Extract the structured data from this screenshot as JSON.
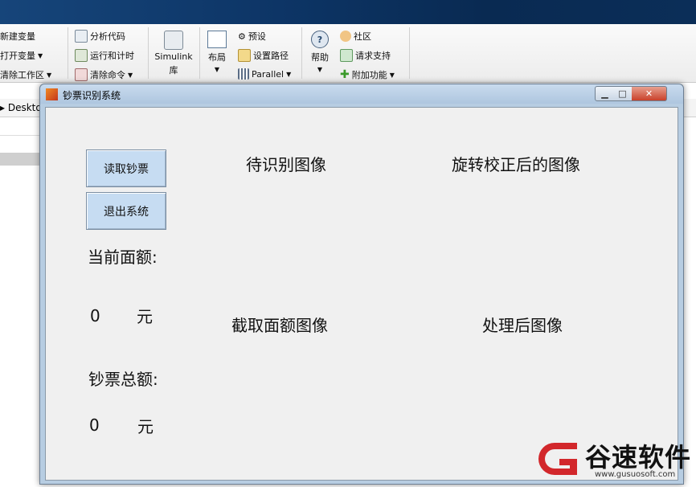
{
  "ribbon": {
    "new_variable": "新建变量",
    "open_variable": "打开变量",
    "clear_workspace": "清除工作区",
    "analyze_code": "分析代码",
    "run_and_time": "运行和计时",
    "clear_commands": "清除命令",
    "simulink_line1": "Simulink",
    "simulink_line2": "库",
    "layout": "布局",
    "preferences": "预设",
    "set_path": "设置路径",
    "parallel": "Parallel",
    "help": "帮助",
    "community": "社区",
    "request_support": "请求支持",
    "addons": "附加功能"
  },
  "path_bar": {
    "text": "▸ Deskto"
  },
  "figure": {
    "title": "钞票识别系统",
    "read_button": "读取钞票",
    "exit_button": "退出系统",
    "pending_image_title": "待识别图像",
    "rotated_image_title": "旋转校正后的图像",
    "crop_image_title": "截取面额图像",
    "processed_image_title": "处理后图像",
    "current_denomination_label": "当前面额:",
    "current_denomination_value": "0",
    "current_unit": "元",
    "total_amount_label": "钞票总额:",
    "total_amount_value": "0",
    "total_unit": "元"
  },
  "watermark": {
    "brand": "谷速软件",
    "url": "www.gusuosoft.com"
  },
  "colors": {
    "button_fill": "#c6dcf2",
    "title_bar": "#b7cde2",
    "top_bar": "#0d3566"
  }
}
